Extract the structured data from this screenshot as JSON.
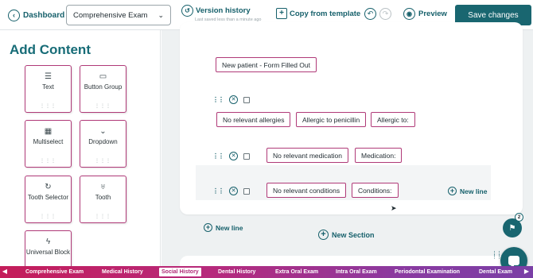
{
  "topbar": {
    "dashboard_label": "Dashboard",
    "exam_select_value": "Comprehensive Exam",
    "version_history_label": "Version history",
    "version_history_sub": "Last saved less than a minute ago",
    "copy_template_label": "Copy from template",
    "preview_label": "Preview",
    "save_label": "Save changes"
  },
  "sidebar": {
    "title": "Add Content",
    "tiles": [
      {
        "label": "Text",
        "icon": "text-lines-icon"
      },
      {
        "label": "Button Group",
        "icon": "button-group-icon"
      },
      {
        "label": "Multiselect",
        "icon": "grid-icon"
      },
      {
        "label": "Dropdown",
        "icon": "chevron-down-icon"
      },
      {
        "label": "Tooth Selector",
        "icon": "rotate-icon"
      },
      {
        "label": "Tooth",
        "icon": "tooth-icon"
      },
      {
        "label": "Universal Block",
        "icon": "lightning-icon"
      }
    ]
  },
  "canvas": {
    "top_chip": "New patient - Form Filled Out",
    "row1": [
      "No relevant allergies",
      "Allergic to penicillin",
      "Allergic to:"
    ],
    "row2": [
      "No relevant medication",
      "Medication:"
    ],
    "row3": [
      "No relevant conditions",
      "Conditions:"
    ],
    "new_line_label": "New line",
    "new_section_label": "New Section",
    "flag_count": "2"
  },
  "tabs": [
    "Comprehensive Exam",
    "Medical History",
    "Social History",
    "Dental History",
    "Extra Oral Exam",
    "Intra Oral Exam",
    "Periodontal Examination",
    "Dental Exam"
  ],
  "active_tab": "Social History",
  "colors": {
    "primary": "#196670",
    "accent": "#b03a78"
  }
}
